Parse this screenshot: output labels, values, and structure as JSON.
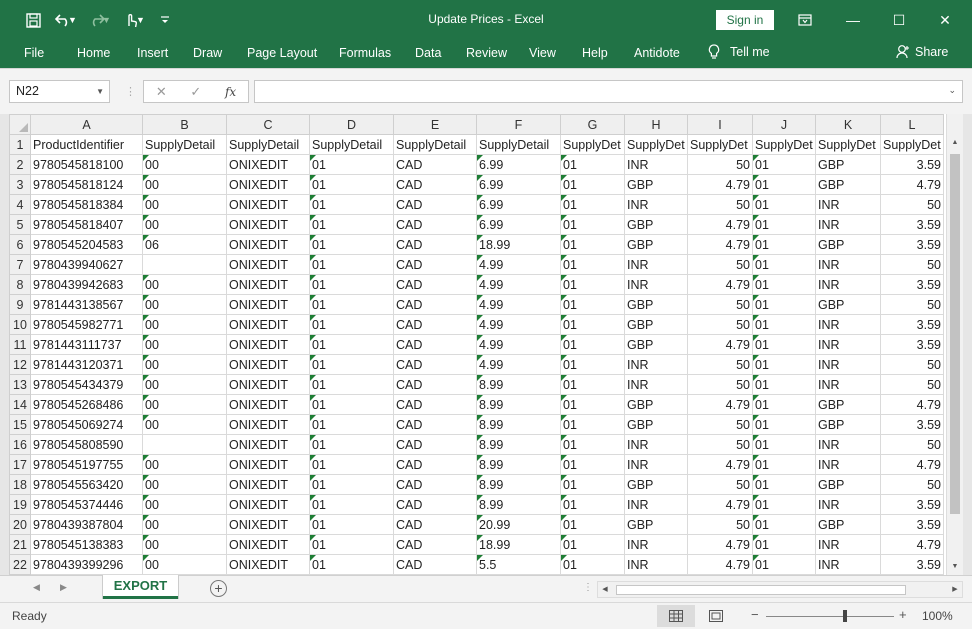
{
  "window": {
    "title": "Update Prices  -  Excel",
    "sign_in": "Sign in",
    "min_glyph": "—",
    "restore_glyph": "☐",
    "close_glyph": "✕"
  },
  "ribbon_tabs": [
    "File",
    "Home",
    "Insert",
    "Draw",
    "Page Layout",
    "Formulas",
    "Data",
    "Review",
    "View",
    "Help",
    "Antidote"
  ],
  "tell_me": "Tell me",
  "share": "Share",
  "name_box": "N22",
  "fx": "fx",
  "columns": [
    "A",
    "B",
    "C",
    "D",
    "E",
    "F",
    "G",
    "H",
    "I",
    "J",
    "K",
    "L"
  ],
  "rows": [
    {
      "n": "1",
      "c": [
        "ProductIdentifier",
        "SupplyDetail",
        "SupplyDetail",
        "SupplyDetail",
        "SupplyDetail",
        "SupplyDetail",
        "SupplyDet",
        "SupplyDet",
        "SupplyDet",
        "SupplyDet",
        "SupplyDet",
        "SupplyDet"
      ]
    },
    {
      "n": "2",
      "c": [
        "9780545818100",
        "00",
        "ONIXEDIT",
        "01",
        "CAD",
        "6.99",
        "01",
        "INR",
        "50",
        "01",
        "GBP",
        "3.59"
      ]
    },
    {
      "n": "3",
      "c": [
        "9780545818124",
        "00",
        "ONIXEDIT",
        "01",
        "CAD",
        "6.99",
        "01",
        "GBP",
        "4.79",
        "01",
        "GBP",
        "4.79"
      ]
    },
    {
      "n": "4",
      "c": [
        "9780545818384",
        "00",
        "ONIXEDIT",
        "01",
        "CAD",
        "6.99",
        "01",
        "INR",
        "50",
        "01",
        "INR",
        "50"
      ]
    },
    {
      "n": "5",
      "c": [
        "9780545818407",
        "00",
        "ONIXEDIT",
        "01",
        "CAD",
        "6.99",
        "01",
        "GBP",
        "4.79",
        "01",
        "INR",
        "3.59"
      ]
    },
    {
      "n": "6",
      "c": [
        "9780545204583",
        "06",
        "ONIXEDIT",
        "01",
        "CAD",
        "18.99",
        "01",
        "GBP",
        "4.79",
        "01",
        "GBP",
        "3.59"
      ]
    },
    {
      "n": "7",
      "c": [
        "9780439940627",
        "",
        "ONIXEDIT",
        "01",
        "CAD",
        "4.99",
        "01",
        "INR",
        "50",
        "01",
        "INR",
        "50"
      ]
    },
    {
      "n": "8",
      "c": [
        "9780439942683",
        "00",
        "ONIXEDIT",
        "01",
        "CAD",
        "4.99",
        "01",
        "INR",
        "4.79",
        "01",
        "INR",
        "3.59"
      ]
    },
    {
      "n": "9",
      "c": [
        "9781443138567",
        "00",
        "ONIXEDIT",
        "01",
        "CAD",
        "4.99",
        "01",
        "GBP",
        "50",
        "01",
        "GBP",
        "50"
      ]
    },
    {
      "n": "10",
      "c": [
        "9780545982771",
        "00",
        "ONIXEDIT",
        "01",
        "CAD",
        "4.99",
        "01",
        "GBP",
        "50",
        "01",
        "INR",
        "3.59"
      ]
    },
    {
      "n": "11",
      "c": [
        "9781443111737",
        "00",
        "ONIXEDIT",
        "01",
        "CAD",
        "4.99",
        "01",
        "GBP",
        "4.79",
        "01",
        "INR",
        "3.59"
      ]
    },
    {
      "n": "12",
      "c": [
        "9781443120371",
        "00",
        "ONIXEDIT",
        "01",
        "CAD",
        "4.99",
        "01",
        "INR",
        "50",
        "01",
        "INR",
        "50"
      ]
    },
    {
      "n": "13",
      "c": [
        "9780545434379",
        "00",
        "ONIXEDIT",
        "01",
        "CAD",
        "8.99",
        "01",
        "INR",
        "50",
        "01",
        "INR",
        "50"
      ]
    },
    {
      "n": "14",
      "c": [
        "9780545268486",
        "00",
        "ONIXEDIT",
        "01",
        "CAD",
        "8.99",
        "01",
        "GBP",
        "4.79",
        "01",
        "GBP",
        "4.79"
      ]
    },
    {
      "n": "15",
      "c": [
        "9780545069274",
        "00",
        "ONIXEDIT",
        "01",
        "CAD",
        "8.99",
        "01",
        "GBP",
        "50",
        "01",
        "GBP",
        "3.59"
      ]
    },
    {
      "n": "16",
      "c": [
        "9780545808590",
        "",
        "ONIXEDIT",
        "01",
        "CAD",
        "8.99",
        "01",
        "INR",
        "50",
        "01",
        "INR",
        "50"
      ]
    },
    {
      "n": "17",
      "c": [
        "9780545197755",
        "00",
        "ONIXEDIT",
        "01",
        "CAD",
        "8.99",
        "01",
        "INR",
        "4.79",
        "01",
        "INR",
        "4.79"
      ]
    },
    {
      "n": "18",
      "c": [
        "9780545563420",
        "00",
        "ONIXEDIT",
        "01",
        "CAD",
        "8.99",
        "01",
        "GBP",
        "50",
        "01",
        "GBP",
        "50"
      ]
    },
    {
      "n": "19",
      "c": [
        "9780545374446",
        "00",
        "ONIXEDIT",
        "01",
        "CAD",
        "8.99",
        "01",
        "INR",
        "4.79",
        "01",
        "INR",
        "3.59"
      ]
    },
    {
      "n": "20",
      "c": [
        "9780439387804",
        "00",
        "ONIXEDIT",
        "01",
        "CAD",
        "20.99",
        "01",
        "GBP",
        "50",
        "01",
        "GBP",
        "3.59"
      ]
    },
    {
      "n": "21",
      "c": [
        "9780545138383",
        "00",
        "ONIXEDIT",
        "01",
        "CAD",
        "18.99",
        "01",
        "INR",
        "4.79",
        "01",
        "INR",
        "4.79"
      ]
    },
    {
      "n": "22",
      "c": [
        "9780439399296",
        "00",
        "ONIXEDIT",
        "01",
        "CAD",
        "5.5",
        "01",
        "INR",
        "4.79",
        "01",
        "INR",
        "3.59"
      ]
    }
  ],
  "sheet_tab": "EXPORT",
  "status": "Ready",
  "zoom": "100%",
  "colors": {
    "brand": "#217346",
    "text_indicator": "#1e7d34"
  }
}
